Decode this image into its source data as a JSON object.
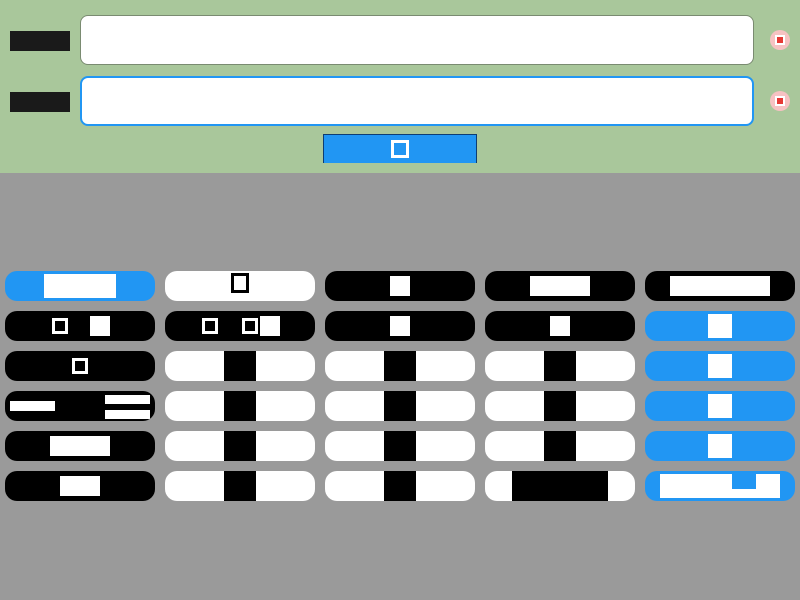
{
  "form": {
    "field1": {
      "value": "",
      "placeholder": ""
    },
    "field2": {
      "value": "",
      "placeholder": ""
    },
    "submit": {
      "label": ""
    }
  },
  "grid": {
    "rows": 6,
    "cols": 5,
    "items_count": 30
  },
  "icons": {
    "error": "error-badge-icon",
    "square": "square-outline-icon"
  },
  "colors": {
    "top_background": "#a9c79b",
    "page_background": "#9a9a9a",
    "accent_blue": "#2196f3",
    "black": "#000000",
    "white": "#ffffff"
  }
}
